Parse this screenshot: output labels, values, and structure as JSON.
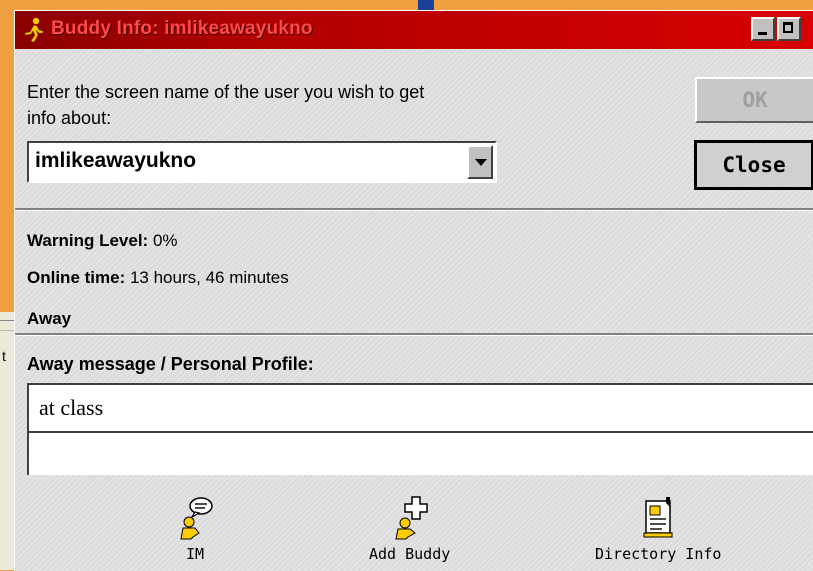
{
  "window": {
    "title": "Buddy Info: imlikeawayukno"
  },
  "lookup": {
    "prompt": "Enter the screen name of the user you wish to get info about:",
    "screen_name": "imlikeawayukno"
  },
  "buttons": {
    "ok": "OK",
    "close": "Close"
  },
  "info": {
    "warning_label": "Warning Level:",
    "warning_value": "0%",
    "online_label": "Online time:",
    "online_value": "13 hours, 46 minutes",
    "status": "Away",
    "away_header": "Away message / Personal Profile:",
    "away_message": "at class"
  },
  "toolbar": {
    "im": "IM",
    "add_buddy": "Add Buddy",
    "directory_info": "Directory Info"
  },
  "background": {
    "left_panel_char": "t"
  },
  "colors": {
    "titlebar": "#b00000",
    "title_text": "#ff4a4a",
    "desktop": "#f0a040"
  }
}
